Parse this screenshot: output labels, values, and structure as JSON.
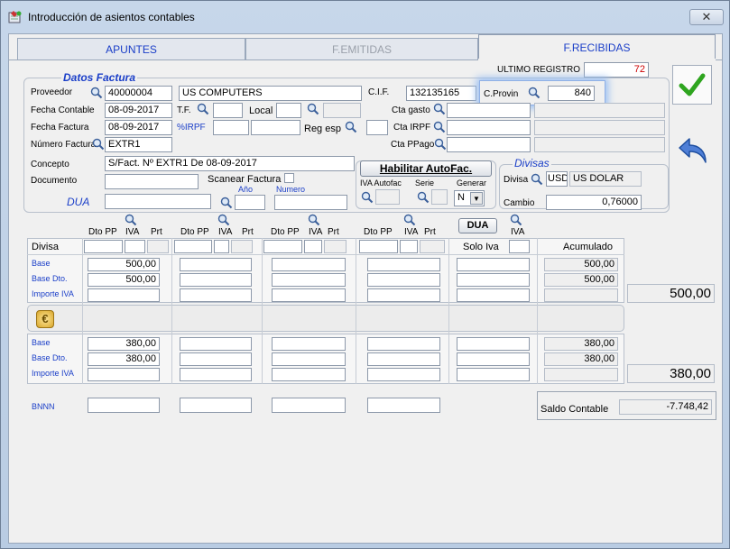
{
  "window": {
    "title": "Introducción de asientos contables",
    "close_label": "✕"
  },
  "tabs": [
    {
      "label": "APUNTES"
    },
    {
      "label": "F.EMITIDAS"
    },
    {
      "label": "F.RECIBIDAS"
    }
  ],
  "ultimo_registro": {
    "label": "ULTIMO REGISTRO",
    "value": "72"
  },
  "datos_factura": {
    "title": "Datos Factura",
    "proveedor_label": "Proveedor",
    "proveedor_code": "40000004",
    "proveedor_name": "US COMPUTERS",
    "cif_label": "C.I.F.",
    "cif_value": "132135165",
    "cprovin_label": "C.Provin",
    "cprovin_value": "840",
    "fecha_contable_label": "Fecha Contable",
    "fecha_contable": "08-09-2017",
    "tf_label": "T.F.",
    "local_label": "Local",
    "cta_gasto_label": "Cta gasto",
    "fecha_factura_label": "Fecha Factura",
    "fecha_factura": "08-09-2017",
    "irpf_label": "%IRPF",
    "reg_esp_label": "Reg esp",
    "cta_irpf_label": "Cta  IRPF",
    "numero_factura_label": "Número Factura",
    "numero_factura": "EXTR1",
    "cta_ppago_label": "Cta PPago",
    "concepto_label": "Concepto",
    "concepto": "S/Fact. Nº EXTR1 De 08-09-2017",
    "documento_label": "Documento",
    "scanear_label": "Scanear Factura",
    "dua_label": "DUA",
    "anio_label": "Año",
    "numero_label": "Numero"
  },
  "autofac": {
    "button": "Habilitar AutoFac.",
    "iva_label": "IVA Autofac",
    "serie_label": "Serie",
    "generar_label": "Generar",
    "generar_value": "N"
  },
  "divisas": {
    "title": "Divisas",
    "divisa_label": "Divisa",
    "code": "USD",
    "name": "US DOLAR",
    "cambio_label": "Cambio",
    "cambio": "0,76000"
  },
  "grid": {
    "dto_pp": "Dto PP",
    "iva": "IVA",
    "prt": "Prt",
    "dua_button": "DUA",
    "divisa_label": "Divisa",
    "solo_iva": "Solo Iva",
    "acumulado": "Acumulado",
    "base_label": "Base",
    "base_dto_label": "Base Dto.",
    "importe_iva_label": "Importe IVA",
    "s1_base": "500,00",
    "s1_base_dto": "500,00",
    "s1_acum_base": "500,00",
    "s1_acum_base_dto": "500,00",
    "s1_total": "500,00",
    "s2_base": "380,00",
    "s2_base_dto": "380,00",
    "s2_acum_base": "380,00",
    "s2_acum_base_dto": "380,00",
    "s2_total": "380,00",
    "bnnn_label": "BNNN",
    "saldo_label": "Saldo Contable",
    "saldo_value": "-7.748,42"
  },
  "colors": {
    "accent": "#1a3ec8",
    "red": "#cc0000"
  }
}
